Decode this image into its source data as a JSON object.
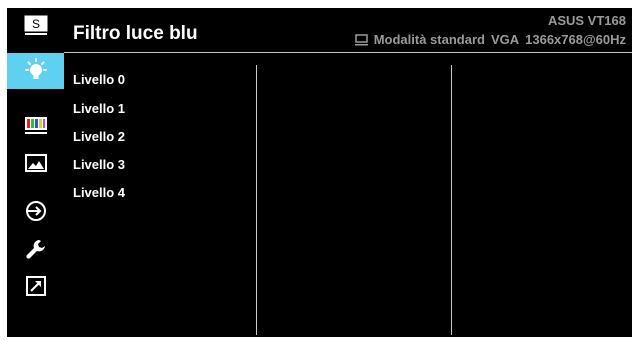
{
  "header": {
    "title": "Filtro luce blu",
    "model": "ASUS VT168",
    "mode": "Modalità standard",
    "input": "VGA",
    "resolution": "1366x768@60Hz",
    "mode_icon": "monitor-icon"
  },
  "sidebar": {
    "items": [
      {
        "icon": "splendid-s-icon",
        "label": "S",
        "active": false
      },
      {
        "icon": "blue-light-icon",
        "active": true
      },
      {
        "icon": "color-bars-icon",
        "active": false
      },
      {
        "icon": "image-icon",
        "active": false
      },
      {
        "icon": "input-select-icon",
        "active": false
      },
      {
        "icon": "wrench-icon",
        "active": false
      },
      {
        "icon": "shortcut-icon",
        "active": false
      }
    ]
  },
  "menu": {
    "items": [
      "Livello 0",
      "Livello 1",
      "Livello 2",
      "Livello 3",
      "Livello 4"
    ]
  },
  "colors": {
    "background": "#000000",
    "accent": "#5fd0f0",
    "text": "#ffffff",
    "muted": "#9a9a9a"
  }
}
